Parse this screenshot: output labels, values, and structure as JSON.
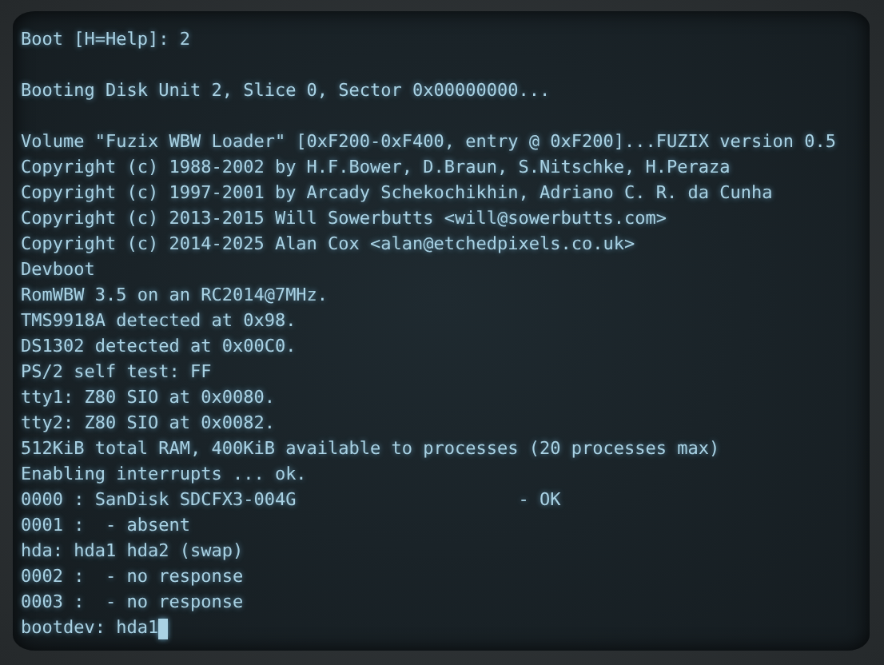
{
  "terminal": {
    "cursor": true,
    "blocks": [
      [
        "Boot [H=Help]: 2"
      ],
      [
        "Booting Disk Unit 2, Slice 0, Sector 0x00000000..."
      ],
      [
        "Volume \"Fuzix WBW Loader\" [0xF200-0xF400, entry @ 0xF200]...FUZIX version 0.5",
        "Copyright (c) 1988-2002 by H.F.Bower, D.Braun, S.Nitschke, H.Peraza",
        "Copyright (c) 1997-2001 by Arcady Schekochikhin, Adriano C. R. da Cunha",
        "Copyright (c) 2013-2015 Will Sowerbutts <will@sowerbutts.com>",
        "Copyright (c) 2014-2025 Alan Cox <alan@etchedpixels.co.uk>",
        "Devboot",
        "RomWBW 3.5 on an RC2014@7MHz.",
        "TMS9918A detected at 0x98.",
        "DS1302 detected at 0x00C0.",
        "PS/2 self test: FF",
        "tty1: Z80 SIO at 0x0080.",
        "tty2: Z80 SIO at 0x0082.",
        "512KiB total RAM, 400KiB available to processes (20 processes max)",
        "Enabling interrupts ... ok.",
        "0000 : SanDisk SDCFX3-004G                     - OK",
        "0001 :  - absent",
        "hda: hda1 hda2 (swap)",
        "0002 :  - no response",
        "0003 :  - no response",
        "bootdev: hda1"
      ]
    ]
  }
}
